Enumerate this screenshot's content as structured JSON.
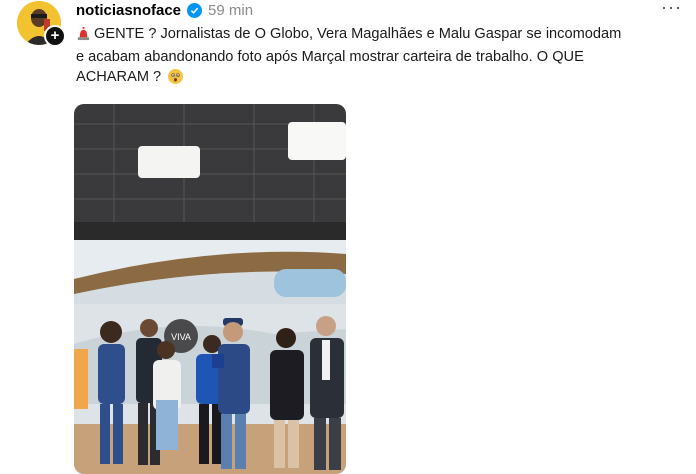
{
  "post": {
    "username": "noticiasnoface",
    "timestamp": "59 min",
    "more_label": "···",
    "caption_line1": "GENTE ? Jornalistas de O Globo, Vera Magalhães e Malu Gaspar se incomodam",
    "caption_line2": "e acabam abandonando foto após Marçal mostrar carteira de trabalho. O QUE",
    "caption_line3": "ACHARAM ?"
  },
  "icons": {
    "siren": "siren-emoji-icon",
    "face": "astonished-face-emoji-icon",
    "verified": "verified-badge-icon",
    "more": "more-options-icon",
    "follow": "plus-icon"
  },
  "media": {
    "set_sign": "VIVA"
  },
  "colors": {
    "verified": "#0095f6",
    "avatar_bg": "#f2c230",
    "timestamp": "#8a8a8a"
  }
}
